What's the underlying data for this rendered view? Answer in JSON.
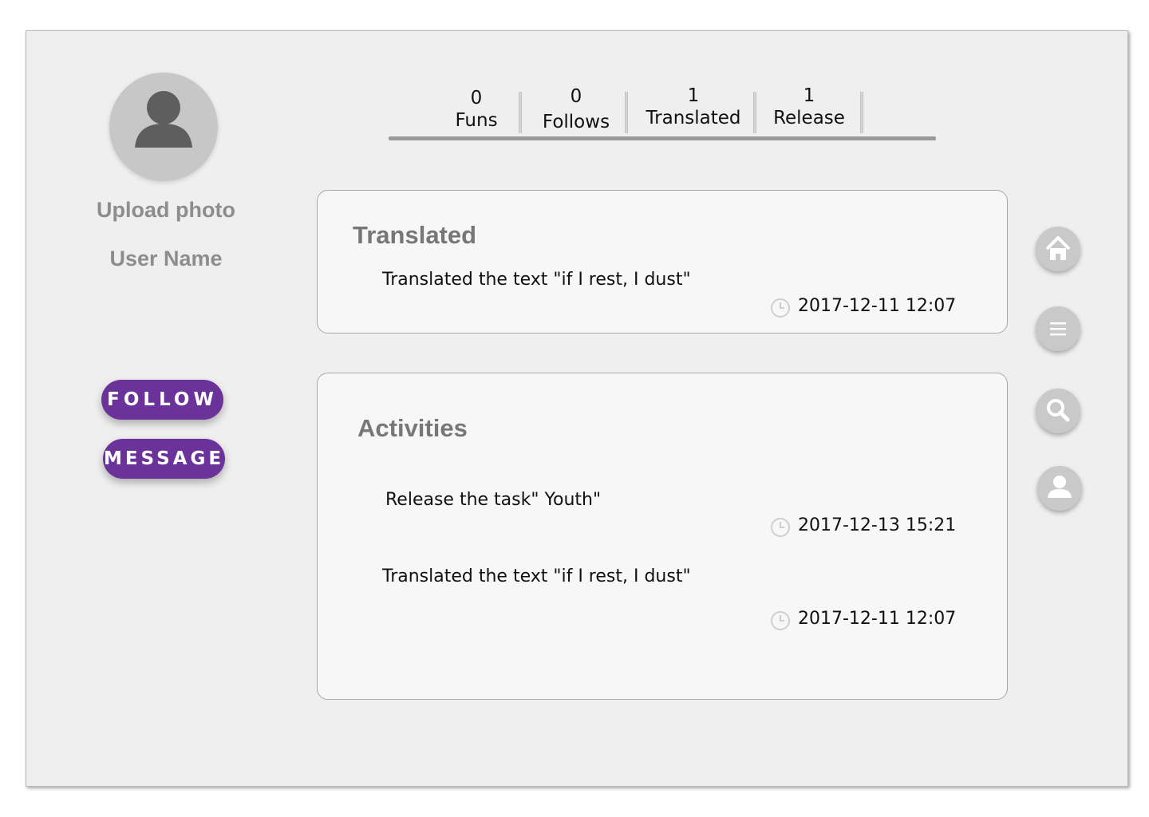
{
  "profile": {
    "upload_label": "Upload photo",
    "user_name": "User Name",
    "avatar_icon": "user-silhouette-icon"
  },
  "actions": {
    "follow_label": "FOLLOW",
    "message_label": "MESSAGE",
    "accent_color": "#6b3299"
  },
  "stats": [
    {
      "value": "0",
      "label": "Funs"
    },
    {
      "value": "0",
      "label": "Follows"
    },
    {
      "value": "1",
      "label": "Translated"
    },
    {
      "value": "1",
      "label": "Release"
    }
  ],
  "translated_card": {
    "title": "Translated",
    "entries": [
      {
        "text": "Translated the text \"if I rest, I dust\"",
        "time": "2017-12-11 12:07"
      }
    ]
  },
  "activities_card": {
    "title": "Activities",
    "entries": [
      {
        "text": "Release the task\" Youth\"",
        "time": "2017-12-13 15:21"
      },
      {
        "text": "Translated the text \"if I rest, I dust\"",
        "time": "2017-12-11 12:07"
      }
    ]
  },
  "side_nav": [
    {
      "icon": "home-icon"
    },
    {
      "icon": "menu-icon"
    },
    {
      "icon": "search-icon"
    },
    {
      "icon": "user-icon"
    }
  ]
}
